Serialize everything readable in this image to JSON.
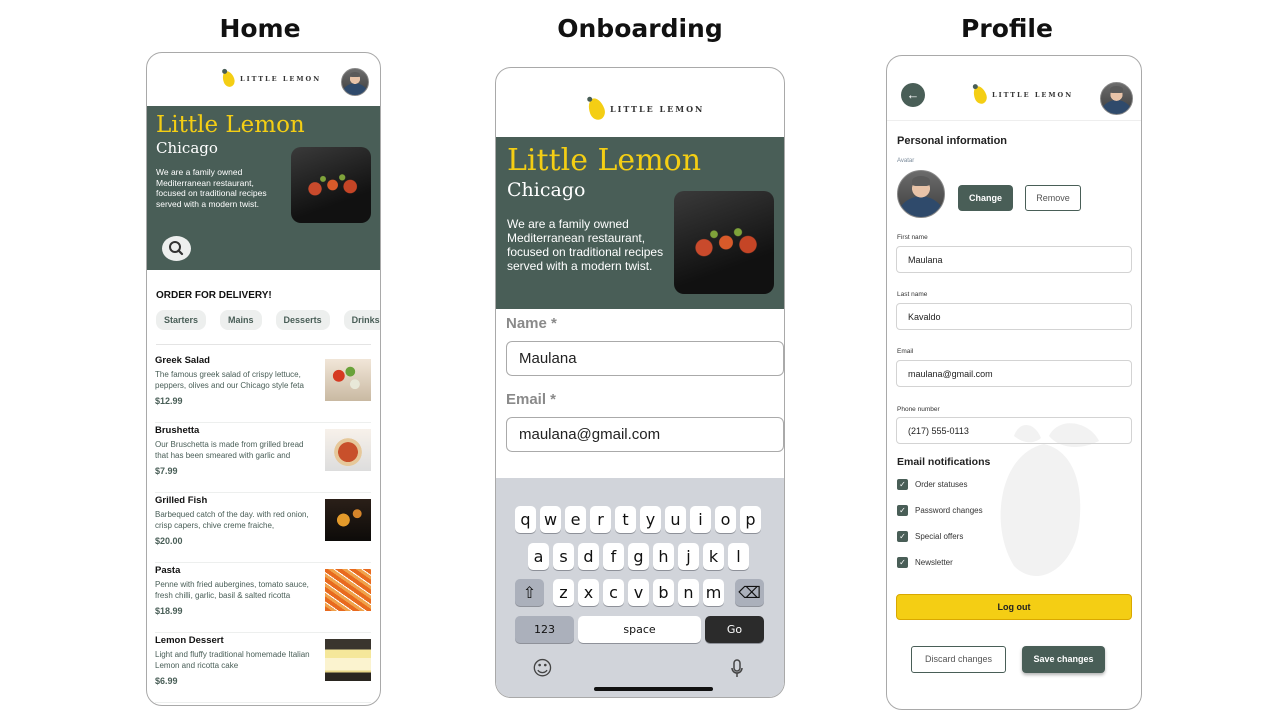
{
  "screens": {
    "home": "Home",
    "onboarding": "Onboarding",
    "profile": "Profile"
  },
  "brand": {
    "logo_text": "LITTLE LEMON",
    "accent": "#f4ce14",
    "primary": "#495e57"
  },
  "hero": {
    "title": "Little Lemon",
    "city": "Chicago",
    "description": "We are a family owned Mediterranean restaurant, focused on traditional recipes served with a modern twist."
  },
  "home": {
    "search_icon": "search-icon",
    "delivery_heading": "ORDER FOR DELIVERY!",
    "categories": [
      "Starters",
      "Mains",
      "Desserts",
      "Drinks"
    ],
    "menu": [
      {
        "name": "Greek Salad",
        "description": "The famous greek salad of crispy lettuce, peppers, olives and our Chicago style feta cheese",
        "price": "$12.99"
      },
      {
        "name": "Brushetta",
        "description": "Our Bruschetta is made from grilled bread that has been smeared with garlic and seasoned with salt and olive oil",
        "price": "$7.99"
      },
      {
        "name": "Grilled Fish",
        "description": "Barbequed catch of the day. with red onion, crisp capers, chive creme fraiche,",
        "price": "$20.00"
      },
      {
        "name": "Pasta",
        "description": "Penne with fried aubergines,  tomato sauce, fresh chilli, garlic, basil & salted ricotta",
        "price": "$18.99"
      },
      {
        "name": "Lemon Dessert",
        "description": "Light and fluffy traditional homemade Italian Lemon and ricotta cake",
        "price": "$6.99"
      }
    ]
  },
  "onboarding": {
    "name_label": "Name *",
    "name_value": "Maulana",
    "email_label": "Email *",
    "email_value": "maulana@gmail.com",
    "keyboard": {
      "row1": [
        "q",
        "w",
        "e",
        "r",
        "t",
        "y",
        "u",
        "i",
        "o",
        "p"
      ],
      "row2": [
        "a",
        "s",
        "d",
        "f",
        "g",
        "h",
        "j",
        "k",
        "l"
      ],
      "row3": [
        "z",
        "x",
        "c",
        "v",
        "b",
        "n",
        "m"
      ],
      "shift": "⇧",
      "backspace": "⌫",
      "numbers": "123",
      "space": "space",
      "go": "Go",
      "emoji": "☺",
      "mic": "🎤"
    }
  },
  "profile": {
    "back_icon": "←",
    "section_title": "Personal information",
    "avatar_label": "Avatar",
    "change_button": "Change",
    "remove_button": "Remove",
    "first_name_label": "First name",
    "first_name_value": "Maulana",
    "last_name_label": "Last name",
    "last_name_value": "Kavaldo",
    "email_label": "Email",
    "email_value": "maulana@gmail.com",
    "phone_label": "Phone number",
    "phone_value": "(217) 555-0113",
    "notifications_title": "Email notifications",
    "notifications": [
      {
        "label": "Order statuses",
        "checked": true
      },
      {
        "label": "Password changes",
        "checked": true
      },
      {
        "label": "Special offers",
        "checked": true
      },
      {
        "label": "Newsletter",
        "checked": true
      }
    ],
    "logout_button": "Log out",
    "discard_button": "Discard changes",
    "save_button": "Save changes"
  }
}
